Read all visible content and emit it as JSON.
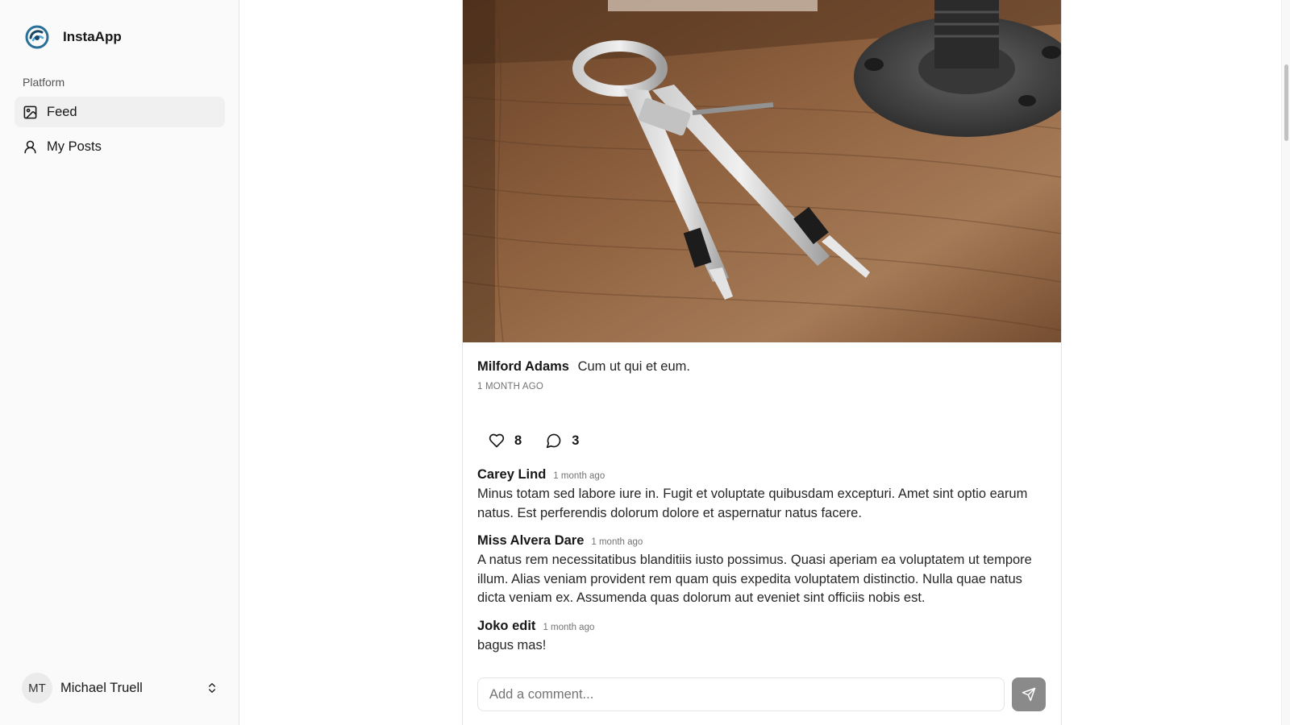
{
  "app": {
    "name": "InstaApp"
  },
  "sidebar": {
    "group_label": "Platform",
    "items": [
      {
        "label": "Feed",
        "icon": "image-icon",
        "active": true
      },
      {
        "label": "My Posts",
        "icon": "user-icon",
        "active": false
      }
    ],
    "user": {
      "initials": "MT",
      "name": "Michael Truell"
    }
  },
  "post": {
    "author": "Milford Adams",
    "caption": "Cum ut qui et eum.",
    "time": "1 MONTH AGO",
    "likes": "8",
    "comments_count": "3",
    "comments": [
      {
        "user": "Carey Lind",
        "time": "1 month ago",
        "text": "Minus totam sed labore iure in. Fugit et voluptate quibusdam excepturi. Amet sint optio earum natus. Est perferendis dolorum dolore et aspernatur natus facere."
      },
      {
        "user": "Miss Alvera Dare",
        "time": "1 month ago",
        "text": "A natus rem necessitatibus blanditiis iusto possimus. Quasi aperiam ea voluptatem ut tempore illum. Alias veniam provident rem quam quis expedita voluptatem distinctio. Nulla quae natus dicta veniam ex. Assumenda quas dolorum aut eveniet sint officiis nobis est."
      },
      {
        "user": "Joko edit",
        "time": "1 month ago",
        "text": "bagus mas!"
      }
    ],
    "comment_placeholder": "Add a comment..."
  },
  "colors": {
    "accent": "#171717",
    "send_button": "#8a8a8a",
    "sidebar_bg": "#fafafa"
  }
}
